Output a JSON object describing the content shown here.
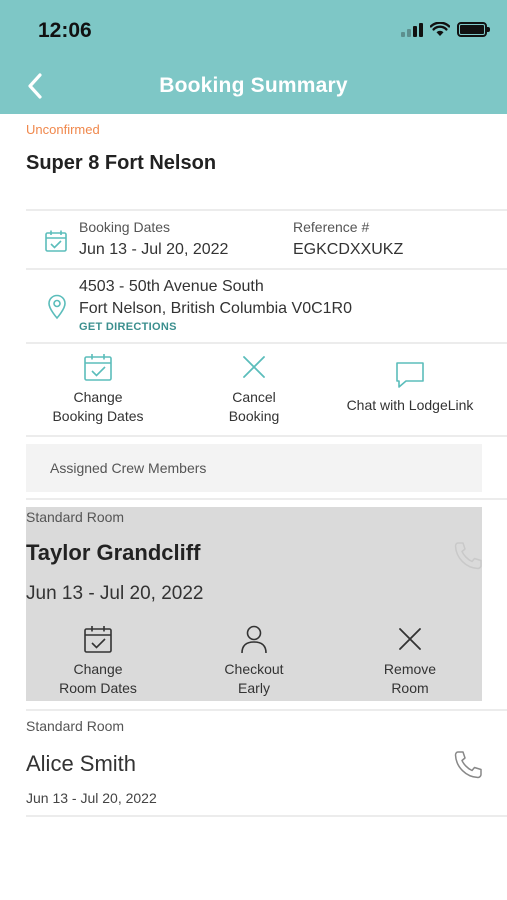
{
  "status_bar": {
    "time": "12:06"
  },
  "header": {
    "title": "Booking Summary"
  },
  "booking": {
    "status": "Unconfirmed",
    "hotel_name": "Super 8 Fort Nelson",
    "dates_label": "Booking Dates",
    "dates_value": "Jun 13 - Jul 20, 2022",
    "reference_label": "Reference #",
    "reference_value": "EGKCDXXUKZ",
    "address_line1": "4503 - 50th Avenue South",
    "address_line2": "Fort Nelson, British Columbia V0C1R0",
    "directions_label": "GET DIRECTIONS"
  },
  "booking_actions": {
    "change_line1": "Change",
    "change_line2": "Booking Dates",
    "cancel_line1": "Cancel",
    "cancel_line2": "Booking",
    "chat": "Chat with LodgeLink"
  },
  "crew": {
    "label": "Assigned Crew Members"
  },
  "rooms": [
    {
      "type": "Standard Room",
      "guest": "Taylor Grandcliff",
      "dates": "Jun 13 - Jul 20, 2022",
      "actions": {
        "change_line1": "Change",
        "change_line2": "Room Dates",
        "checkout_line1": "Checkout",
        "checkout_line2": "Early",
        "remove_line1": "Remove",
        "remove_line2": "Room"
      }
    },
    {
      "type": "Standard Room",
      "guest": "Alice Smith",
      "dates": "Jun 13 - Jul 20, 2022"
    }
  ],
  "colors": {
    "header_bg": "#7ec7c6",
    "accent_teal": "#5bbdbb",
    "unconfirmed": "#f0884c",
    "selected_card": "#dadada"
  }
}
